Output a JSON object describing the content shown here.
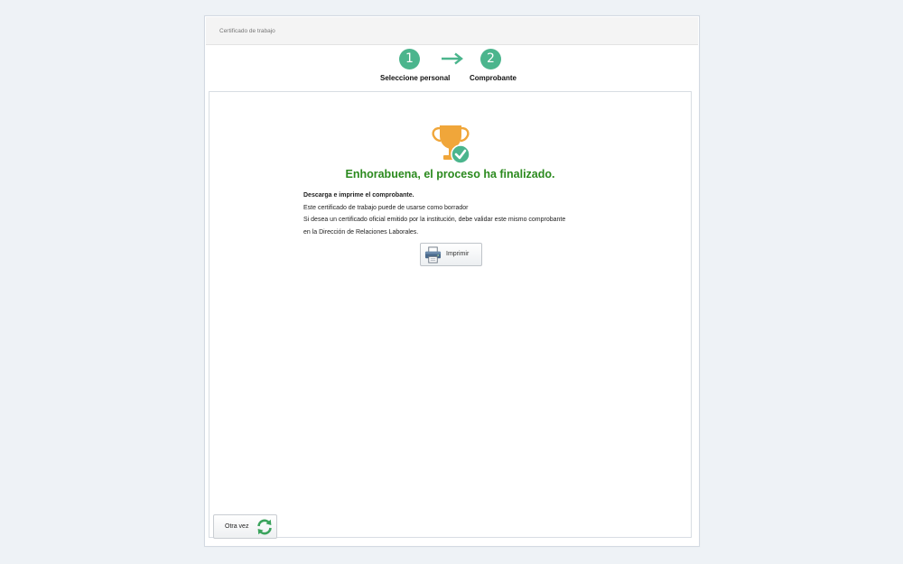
{
  "window": {
    "title": "Certificado de trabajo"
  },
  "steps": [
    {
      "number": "1",
      "label": "Seleccione personal"
    },
    {
      "number": "2",
      "label": "Comprobante"
    }
  ],
  "result": {
    "title": "Enhorabuena, el proceso ha finalizado.",
    "lines": [
      "Descarga e imprime el comprobante.",
      "Este certificado de trabajo puede de usarse como borrador",
      "Si desea un certificado oficial emitido por la institución, debe validar este mismo comprobante",
      "en la Dirección de Relaciones Laborales."
    ],
    "print_label": "Imprimir"
  },
  "footer": {
    "again_label": "Otra vez"
  },
  "icons": {
    "step_arrow": "arrow-right-icon",
    "trophy": "trophy-check-icon",
    "print": "printer-icon",
    "again": "refresh-icon"
  },
  "colors": {
    "accent": "#4bb58d",
    "success": "#2b8a1e",
    "trophy": "#f0a63a"
  }
}
